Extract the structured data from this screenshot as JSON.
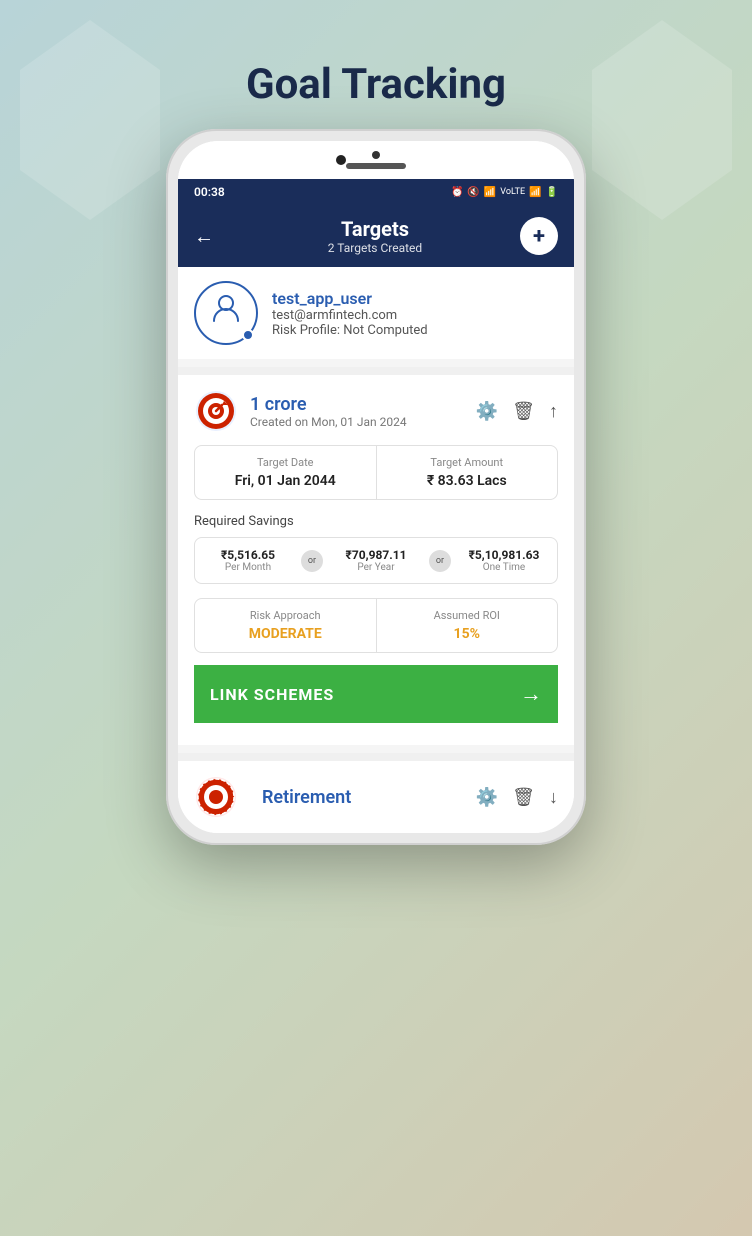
{
  "page": {
    "title": "Goal Tracking"
  },
  "status_bar": {
    "time": "00:38",
    "icons": "⏰ 🔇 📶 LTE₁ 📶₂ 🔋"
  },
  "header": {
    "back_label": "←",
    "title": "Targets",
    "subtitle": "2 Targets Created",
    "add_label": "+"
  },
  "user": {
    "name": "test_app_user",
    "email": "test@armfintech.com",
    "risk_profile": "Risk Profile: Not Computed"
  },
  "goals": [
    {
      "name": "1 crore",
      "created_on": "Created on Mon, 01 Jan 2024",
      "target_date_label": "Target Date",
      "target_date_value": "Fri, 01 Jan 2044",
      "target_amount_label": "Target Amount",
      "target_amount_value": "₹ 83.63 Lacs",
      "required_savings_label": "Required Savings",
      "per_month_amount": "₹5,516.65",
      "per_month_label": "Per Month",
      "per_year_amount": "₹70,987.11",
      "per_year_label": "Per Year",
      "one_time_amount": "₹5,10,981.63",
      "one_time_label": "One Time",
      "or_label": "or",
      "risk_approach_label": "Risk Approach",
      "risk_approach_value": "MODERATE",
      "assumed_roi_label": "Assumed ROI",
      "assumed_roi_value": "15%",
      "link_schemes_label": "LINK SCHEMES",
      "arrow": "→"
    },
    {
      "name": "Retirement",
      "icon_type": "retirement"
    }
  ]
}
